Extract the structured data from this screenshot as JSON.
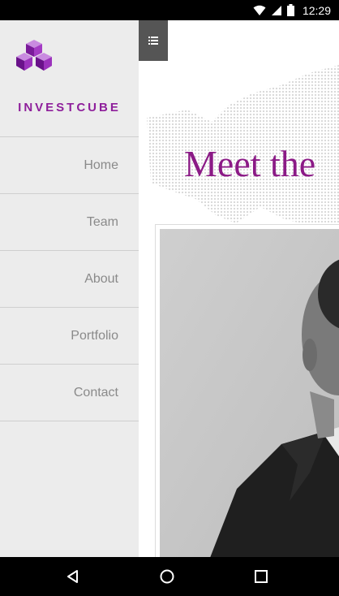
{
  "status_bar": {
    "time": "12:29",
    "icons": [
      "wifi-icon",
      "signal-icon",
      "battery-icon"
    ]
  },
  "drawer": {
    "brand": "INVESTCUBE",
    "logo_icon": "cubes-logo-icon",
    "items": [
      {
        "label": "Home"
      },
      {
        "label": "Team"
      },
      {
        "label": "About"
      },
      {
        "label": "Portfolio"
      },
      {
        "label": "Contact"
      }
    ]
  },
  "main": {
    "headline": "Meet the",
    "menu_icon": "list-icon"
  },
  "colors": {
    "brand": "#8e1f9b",
    "headline": "#8b1a86",
    "drawer_bg": "#ececec"
  },
  "system_nav": [
    "back-icon",
    "home-icon",
    "recents-icon"
  ]
}
